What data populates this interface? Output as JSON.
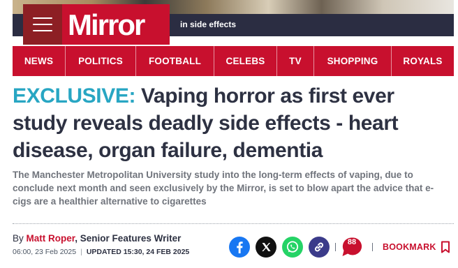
{
  "caption": {
    "text": "in side effects"
  },
  "logo": {
    "text": "Mirror",
    "brand_color": "#c8102e"
  },
  "menu": {
    "icon": "hamburger-menu-icon"
  },
  "nav": {
    "items": [
      {
        "label": "NEWS"
      },
      {
        "label": "POLITICS"
      },
      {
        "label": "FOOTBALL"
      },
      {
        "label": "CELEBS"
      },
      {
        "label": "TV"
      },
      {
        "label": "SHOPPING"
      },
      {
        "label": "ROYALS"
      }
    ]
  },
  "article": {
    "kicker": "EXCLUSIVE:",
    "headline": "Vaping horror as first ever study reveals deadly side effects - heart disease, organ failure, dementia",
    "standfirst": "The Manchester Metropolitan University study into the long-term effects of vaping, due to conclude next month and seen exclusively by the Mirror, is set to blow apart the advice that e-cigs are a healthier alternative to cigarettes",
    "kicker_color": "#28a6c3"
  },
  "byline": {
    "by": "By",
    "author": "Matt Roper",
    "role": ", Senior Features Writer",
    "published": "06:00, 23 Feb 2025",
    "updated": "UPDATED 15:30, 24 FEB 2025"
  },
  "share": {
    "icons": [
      "facebook-icon",
      "x-icon",
      "whatsapp-icon",
      "link-icon"
    ],
    "comment_count": "88",
    "bookmark_label": "BOOKMARK"
  }
}
